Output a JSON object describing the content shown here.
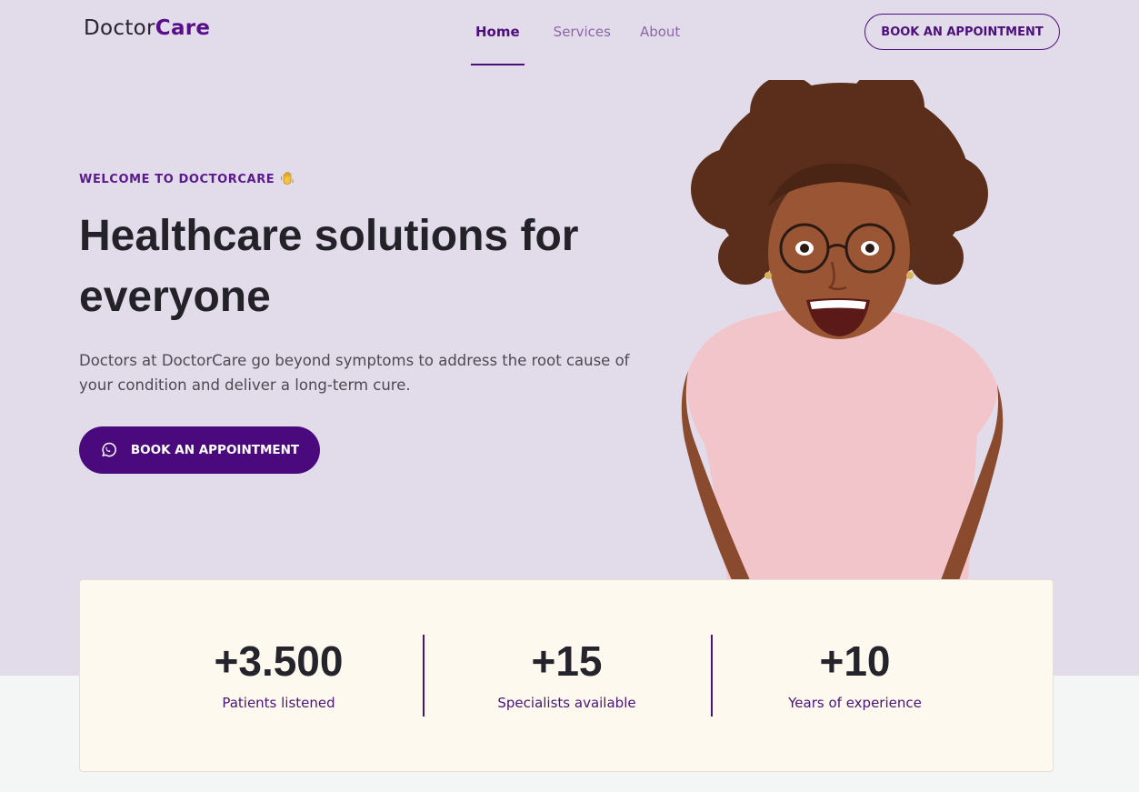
{
  "header": {
    "logo_primary": "Doctor",
    "logo_accent": "Care",
    "nav": [
      {
        "label": "Home",
        "active": true
      },
      {
        "label": "Services",
        "active": false
      },
      {
        "label": "About",
        "active": false
      }
    ],
    "book_button": "BOOK AN APPOINTMENT"
  },
  "hero": {
    "eyebrow": "WELCOME TO DOCTORCARE",
    "eyebrow_icon": "waving-hand-icon",
    "title": "Healthcare solutions for everyone",
    "subtitle": "Doctors at DoctorCare go beyond symptoms to address the root cause of your condition and deliver a long-term cure.",
    "cta_label": "BOOK AN APPOINTMENT",
    "cta_icon": "whatsapp-icon"
  },
  "stats": [
    {
      "value": "+3.500",
      "label": "Patients listened"
    },
    {
      "value": "+15",
      "label": "Specialists available"
    },
    {
      "value": "+10",
      "label": "Years of experience"
    }
  ],
  "colors": {
    "hero_background": "#e2dcea",
    "primary": "#4a0a7e",
    "stats_background": "#fdf9ef",
    "page_background": "#f4f5f5"
  }
}
